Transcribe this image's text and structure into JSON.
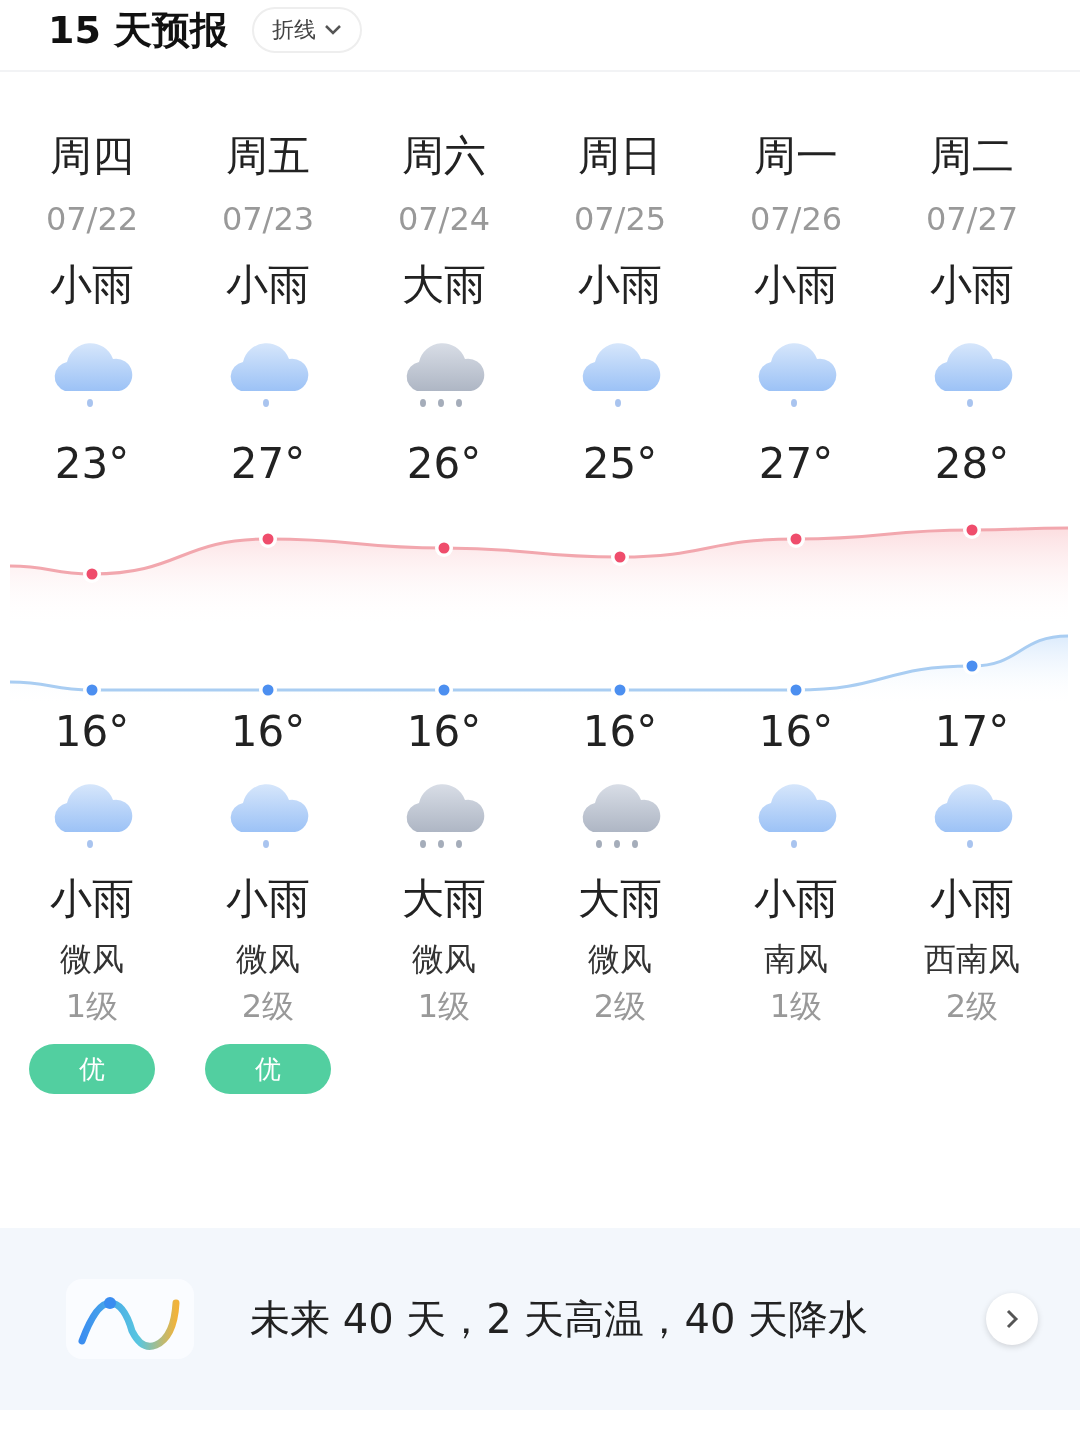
{
  "header": {
    "title": "15 天预报",
    "view_toggle": "折线"
  },
  "days": [
    {
      "weekday": "周四",
      "date": "07/22",
      "day_condition": "小雨",
      "day_icon": {
        "kind": "light"
      },
      "high": "23°",
      "low": "16°",
      "night_icon": {
        "kind": "light"
      },
      "night_condition": "小雨",
      "wind": "微风",
      "wind_level": "1级",
      "aqi": "优"
    },
    {
      "weekday": "周五",
      "date": "07/23",
      "day_condition": "小雨",
      "day_icon": {
        "kind": "light"
      },
      "high": "27°",
      "low": "16°",
      "night_icon": {
        "kind": "light"
      },
      "night_condition": "小雨",
      "wind": "微风",
      "wind_level": "2级",
      "aqi": "优"
    },
    {
      "weekday": "周六",
      "date": "07/24",
      "day_condition": "大雨",
      "day_icon": {
        "kind": "heavy"
      },
      "high": "26°",
      "low": "16°",
      "night_icon": {
        "kind": "heavy"
      },
      "night_condition": "大雨",
      "wind": "微风",
      "wind_level": "1级"
    },
    {
      "weekday": "周日",
      "date": "07/25",
      "day_condition": "小雨",
      "day_icon": {
        "kind": "light"
      },
      "high": "25°",
      "low": "16°",
      "night_icon": {
        "kind": "heavy"
      },
      "night_condition": "大雨",
      "wind": "微风",
      "wind_level": "2级"
    },
    {
      "weekday": "周一",
      "date": "07/26",
      "day_condition": "小雨",
      "day_icon": {
        "kind": "light"
      },
      "high": "27°",
      "low": "16°",
      "night_icon": {
        "kind": "light"
      },
      "night_condition": "小雨",
      "wind": "南风",
      "wind_level": "1级"
    },
    {
      "weekday": "周二",
      "date": "07/27",
      "day_condition": "小雨",
      "day_icon": {
        "kind": "light"
      },
      "high": "28°",
      "low": "17°",
      "night_icon": {
        "kind": "light"
      },
      "night_condition": "小雨",
      "wind": "西南风",
      "wind_level": "2级"
    }
  ],
  "banner": {
    "text": "未来 40 天，2 天高温，40 天降水"
  }
}
